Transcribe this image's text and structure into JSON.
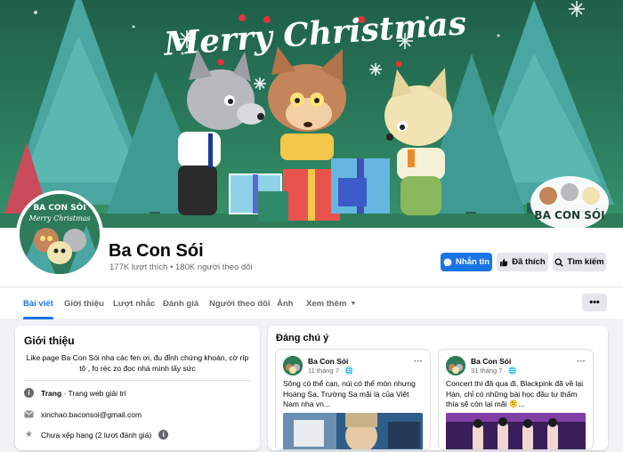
{
  "cover": {
    "greeting": "Merry Christmas",
    "logo_text": "BA CON SÓI"
  },
  "profile": {
    "name": "Ba Con Sói",
    "stats": "177K lượt thích • 180K người theo dõi",
    "avatar_caption_top": "BA CON SÓI",
    "avatar_caption_sub": "Merry Christmas"
  },
  "actions": {
    "message": "Nhắn tin",
    "liked": "Đã thích",
    "search": "Tìm kiếm"
  },
  "tabs": [
    {
      "label": "Bài viết"
    },
    {
      "label": "Giới thiệu"
    },
    {
      "label": "Lượt nhắc"
    },
    {
      "label": "Đánh giá"
    },
    {
      "label": "Người theo dõi"
    },
    {
      "label": "Ảnh"
    },
    {
      "label": "Xem thêm"
    }
  ],
  "more_button": "•••",
  "intro": {
    "title": "Giới thiệu",
    "bio": "Like page Ba Con Sói nha các fen ơi, đu đỉnh chứng khoán, cờ ríp tô , fo réc zo đọc nhà mình lấy sức",
    "category_label": "Trang",
    "category_value": " · Trang web giải trí",
    "email": "xinchao.baconsoi@gmail.com",
    "rating": "Chưa xếp hạng (2 lượt đánh giá)"
  },
  "featured": {
    "title": "Đáng chú ý",
    "posts": [
      {
        "author": "Ba Con Sói",
        "date": "11 tháng 7 ·",
        "text": "Sông có thể cạn, núi có thể mòn nhưng Hoàng Sa, Trường Sa mãi là của Việt Nam nha vn..."
      },
      {
        "author": "Ba Con Sói",
        "date": "31 tháng 7 ·",
        "text": "Concert thì đã qua đi, Blackpink đã về lại Hàn, chỉ có những bài học đầu tư thấm thía sẽ còn lại mãi 🫠..."
      }
    ]
  },
  "colors": {
    "accent": "#1b74e4",
    "cover_green": "#2a7a5c"
  }
}
